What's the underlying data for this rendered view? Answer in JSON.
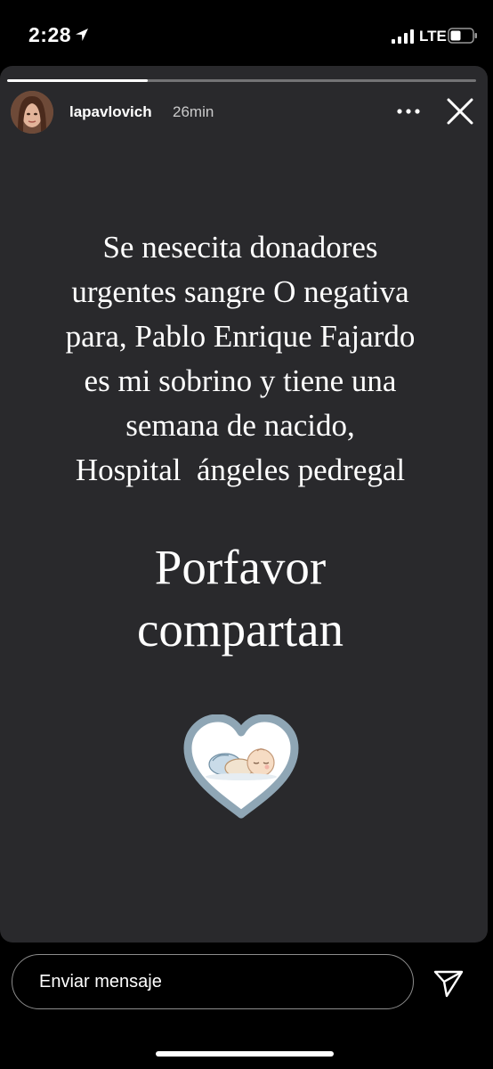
{
  "status_bar": {
    "time": "2:28",
    "network": "LTE",
    "icons": [
      "location-arrow-icon",
      "signal-icon",
      "battery-icon"
    ]
  },
  "story": {
    "username": "lapavlovich",
    "time_ago": "26min",
    "progress": 0.3,
    "message_lines": [
      "Se nesecita donadores",
      "urgentes sangre O negativa",
      "para, Pablo Enrique Fajardo",
      "es mi sobrino y tiene una",
      "semana de nacido,",
      "Hospital  ángeles pedregal"
    ],
    "cta_lines": [
      "Porfavor",
      "compartan"
    ],
    "icons": [
      "more-icon",
      "close-icon",
      "baby-heart-sticker"
    ]
  },
  "reply": {
    "placeholder": "Enviar mensaje",
    "icons": [
      "send-icon"
    ]
  },
  "colors": {
    "background": "#000000",
    "card": "#29292c",
    "text": "#ffffff",
    "heart_border": "#8fa6b5"
  }
}
